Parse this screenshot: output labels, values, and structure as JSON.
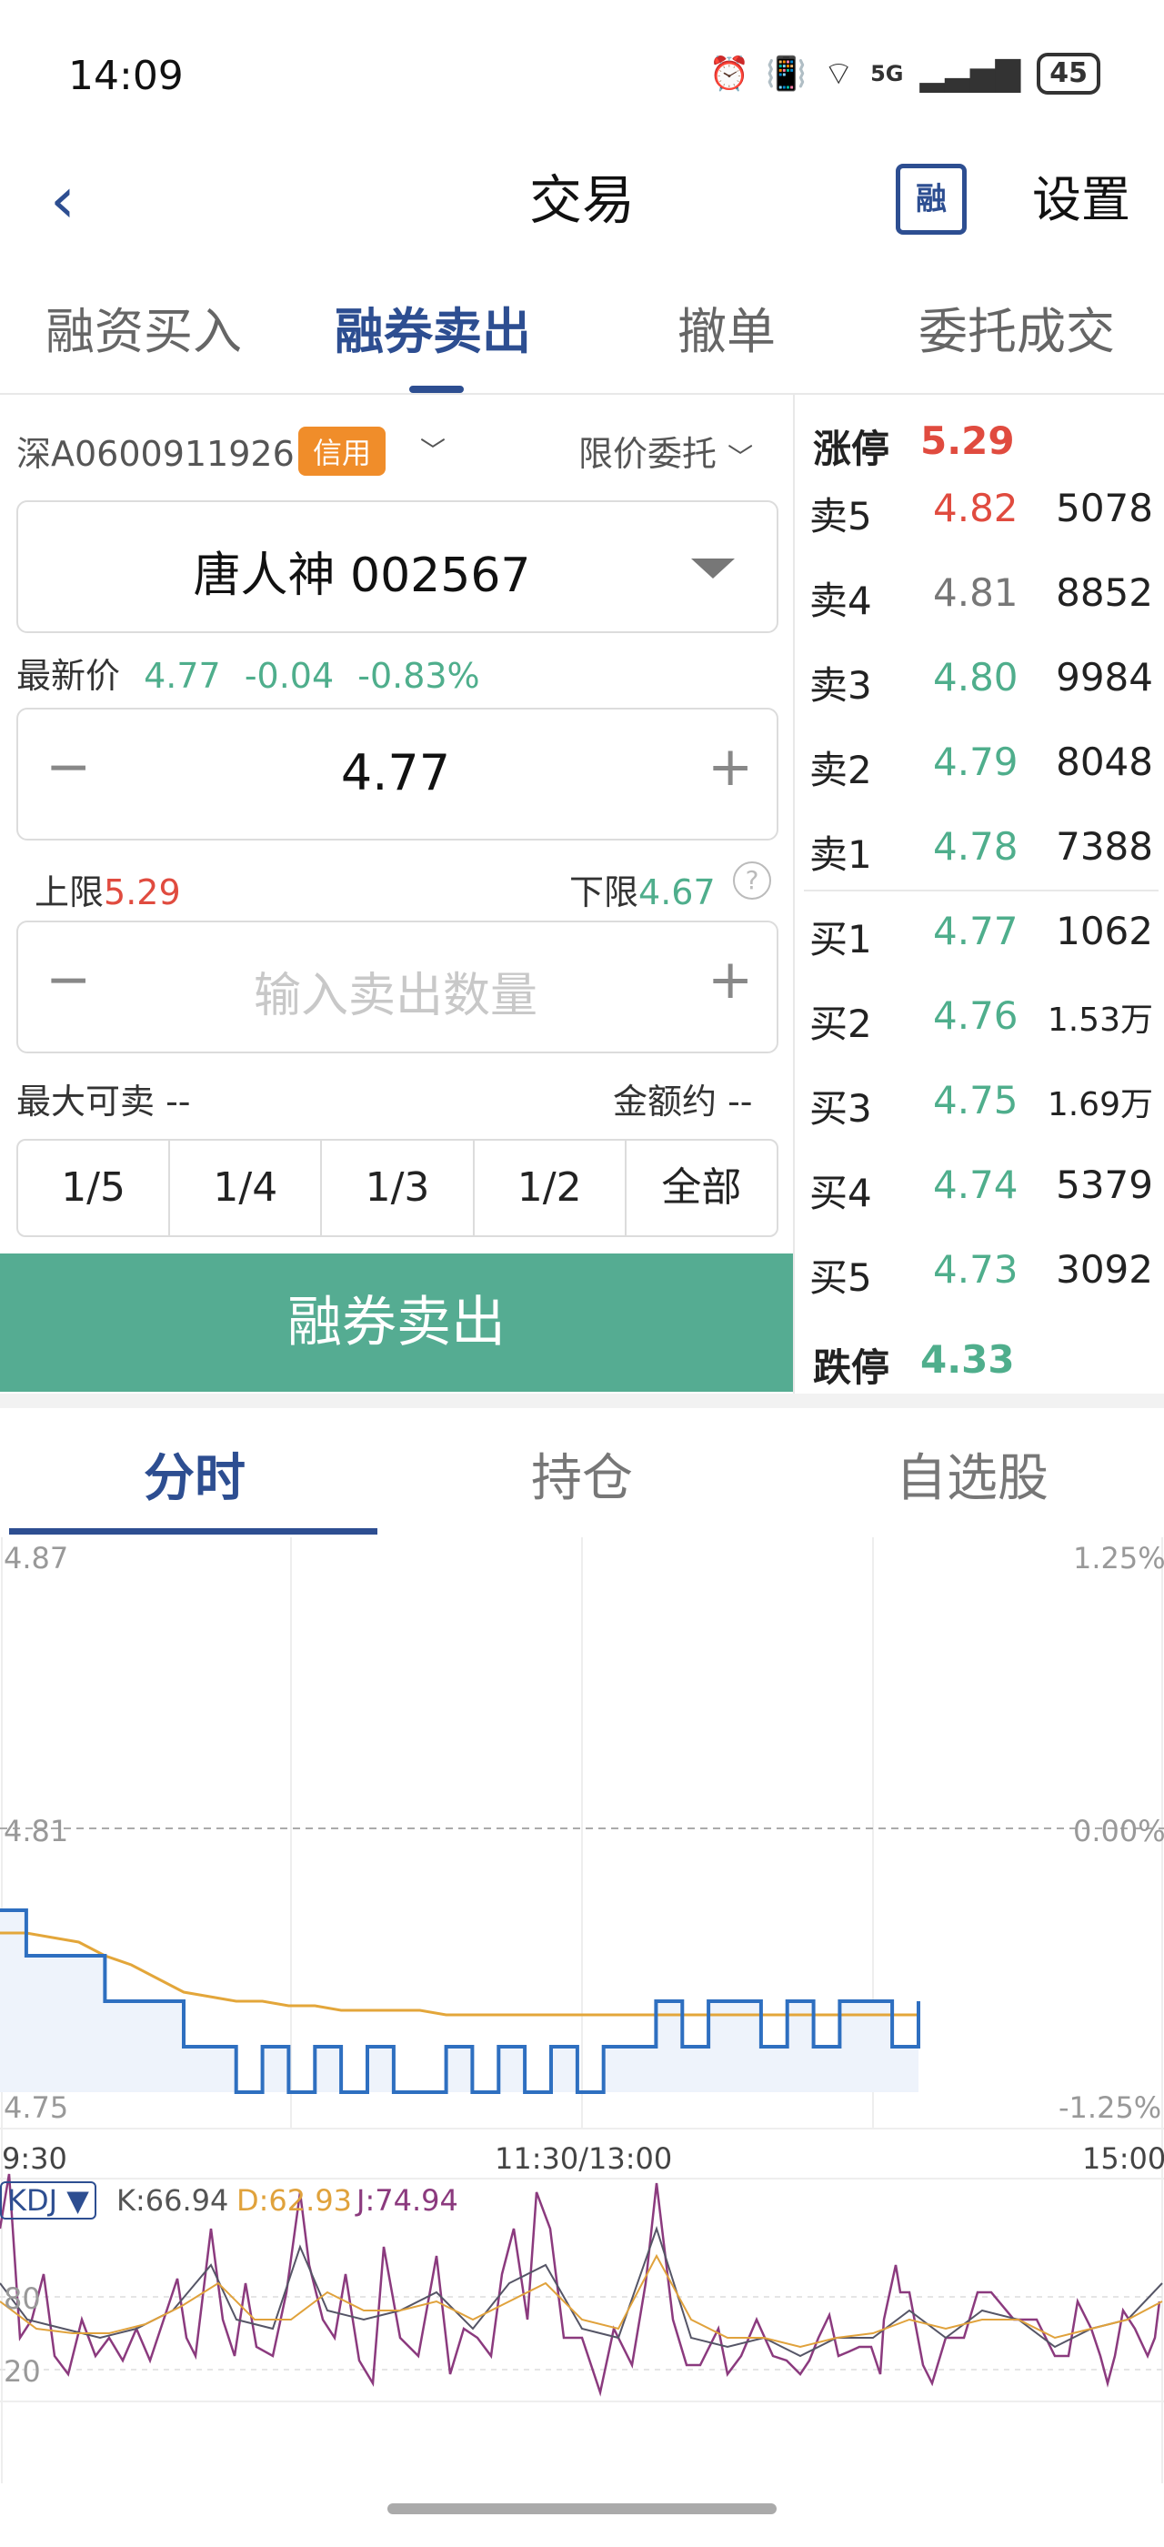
{
  "status": {
    "time": "14:09",
    "network": "5G",
    "battery": "45"
  },
  "nav": {
    "title": "交易",
    "rong_icon": "融",
    "settings": "设置"
  },
  "tabs": [
    "融资买入",
    "融券卖出",
    "撤单",
    "委托成交"
  ],
  "form": {
    "account": "深A0600911926",
    "account_badge": "信用",
    "order_type": "限价委托",
    "stock": "唐人神 002567",
    "latest_label": "最新价",
    "latest_price": "4.77",
    "latest_change": "-0.04",
    "latest_pct": "-0.83%",
    "price": "4.77",
    "upper_label": "上限",
    "upper_value": "5.29",
    "lower_label": "下限",
    "lower_value": "4.67",
    "qty_placeholder": "输入卖出数量",
    "max_sell": "最大可卖 --",
    "amount": "金额约 --",
    "fractions": [
      "1/5",
      "1/4",
      "1/3",
      "1/2",
      "全部"
    ],
    "submit": "融券卖出"
  },
  "orderbook": {
    "limit_up_label": "涨停",
    "limit_up": "5.29",
    "limit_down_label": "跌停",
    "limit_down": "4.33",
    "rows": [
      {
        "label": "卖5",
        "price": "4.82",
        "vol": "5078"
      },
      {
        "label": "卖4",
        "price": "4.81",
        "vol": "8852"
      },
      {
        "label": "卖3",
        "price": "4.80",
        "vol": "9984"
      },
      {
        "label": "卖2",
        "price": "4.79",
        "vol": "8048"
      },
      {
        "label": "卖1",
        "price": "4.78",
        "vol": "7388"
      },
      {
        "label": "买1",
        "price": "4.77",
        "vol": "1062"
      },
      {
        "label": "买2",
        "price": "4.76",
        "vol": "1.53万"
      },
      {
        "label": "买3",
        "price": "4.75",
        "vol": "1.69万"
      },
      {
        "label": "买4",
        "price": "4.74",
        "vol": "5379"
      },
      {
        "label": "买5",
        "price": "4.73",
        "vol": "3092"
      }
    ],
    "colors": {
      "red": "#e04b3f",
      "gray": "#777777",
      "green": "#4fae8c"
    }
  },
  "bottom_tabs": [
    "分时",
    "持仓",
    "自选股"
  ],
  "chart": {
    "y_top": "4.87",
    "y_mid": "4.81",
    "y_bot": "4.75",
    "pct_top": "1.25%",
    "pct_mid": "0.00%",
    "pct_bot": "-1.25%",
    "x_start": "9:30",
    "x_mid": "11:30/13:00",
    "x_end": "15:00",
    "kdj_label": "KDJ ▼",
    "k": "K:66.94",
    "d": "D:62.93",
    "j": "J:74.94",
    "kdj_80": "80",
    "kdj_20": "20"
  },
  "chart_data": {
    "type": "line",
    "ylim": [
      4.75,
      4.87
    ],
    "series": [
      {
        "values": [
          4.79,
          4.78,
          4.78,
          4.78,
          4.77,
          4.77,
          4.77,
          4.76,
          4.76,
          4.75,
          4.76,
          4.75,
          4.76,
          4.75,
          4.76,
          4.75,
          4.75,
          4.76,
          4.75,
          4.76,
          4.75,
          4.76,
          4.75,
          4.76,
          4.76,
          4.77,
          4.76,
          4.77,
          4.77,
          4.76,
          4.77,
          4.76,
          4.77,
          4.77,
          4.76,
          4.77
        ]
      },
      {
        "values": [
          4.785,
          4.785,
          4.784,
          4.783,
          4.78,
          4.778,
          4.775,
          4.772,
          4.771,
          4.77,
          4.77,
          4.769,
          4.769,
          4.768,
          4.768,
          4.768,
          4.768,
          4.767,
          4.767,
          4.767,
          4.767,
          4.767,
          4.767,
          4.767,
          4.767,
          4.767,
          4.767,
          4.767,
          4.767,
          4.767,
          4.767,
          4.767,
          4.767,
          4.767,
          4.767,
          4.767
        ]
      }
    ]
  }
}
